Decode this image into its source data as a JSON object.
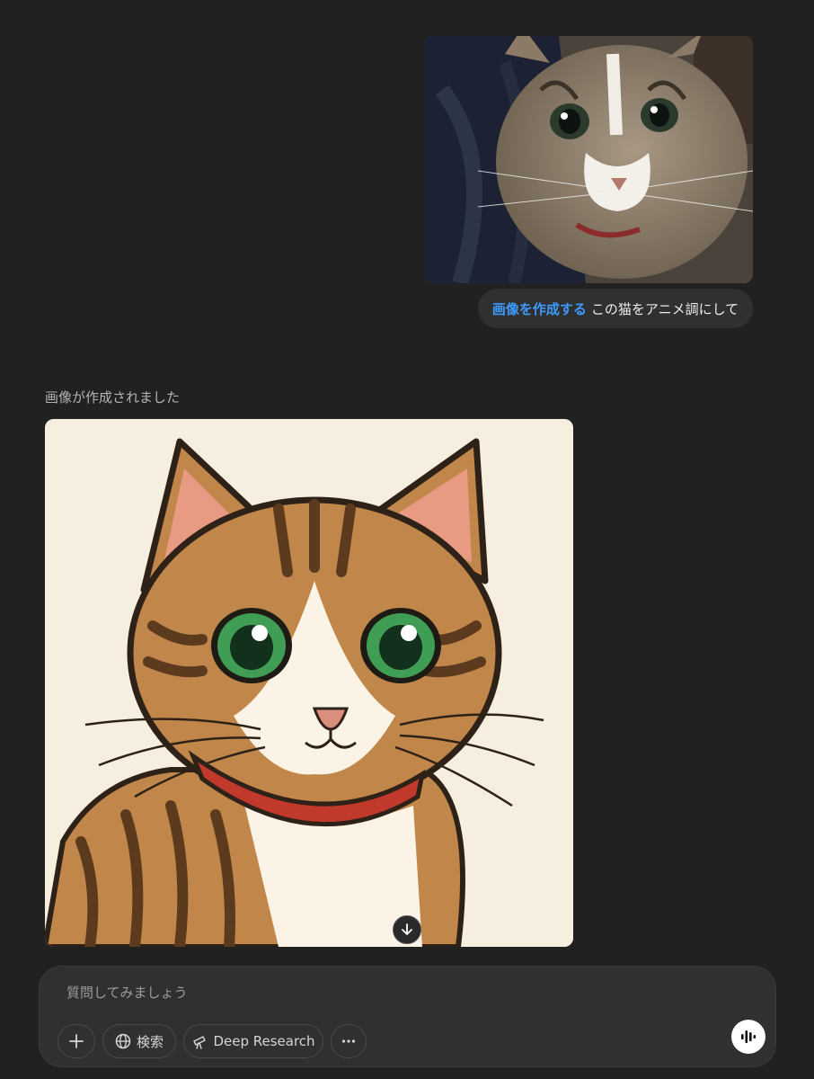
{
  "user_message": {
    "tag": "画像を作成する",
    "text": "この猫をアニメ調にして",
    "attachment_icon": "cat-photo"
  },
  "assistant": {
    "status": "画像が作成されました",
    "image_icon": "anime-cat-illustration",
    "download_icon": "arrow-down-icon"
  },
  "composer": {
    "placeholder": "質問してみましょう",
    "buttons": {
      "add_icon": "plus-icon",
      "search_label": "検索",
      "search_icon": "globe-icon",
      "deep_research_label": "Deep Research",
      "deep_research_icon": "telescope-icon",
      "more_icon": "ellipsis-icon",
      "voice_icon": "voice-waveform-icon"
    }
  },
  "colors": {
    "background": "#212121",
    "bubble": "#303030",
    "accent": "#3d9bff"
  }
}
